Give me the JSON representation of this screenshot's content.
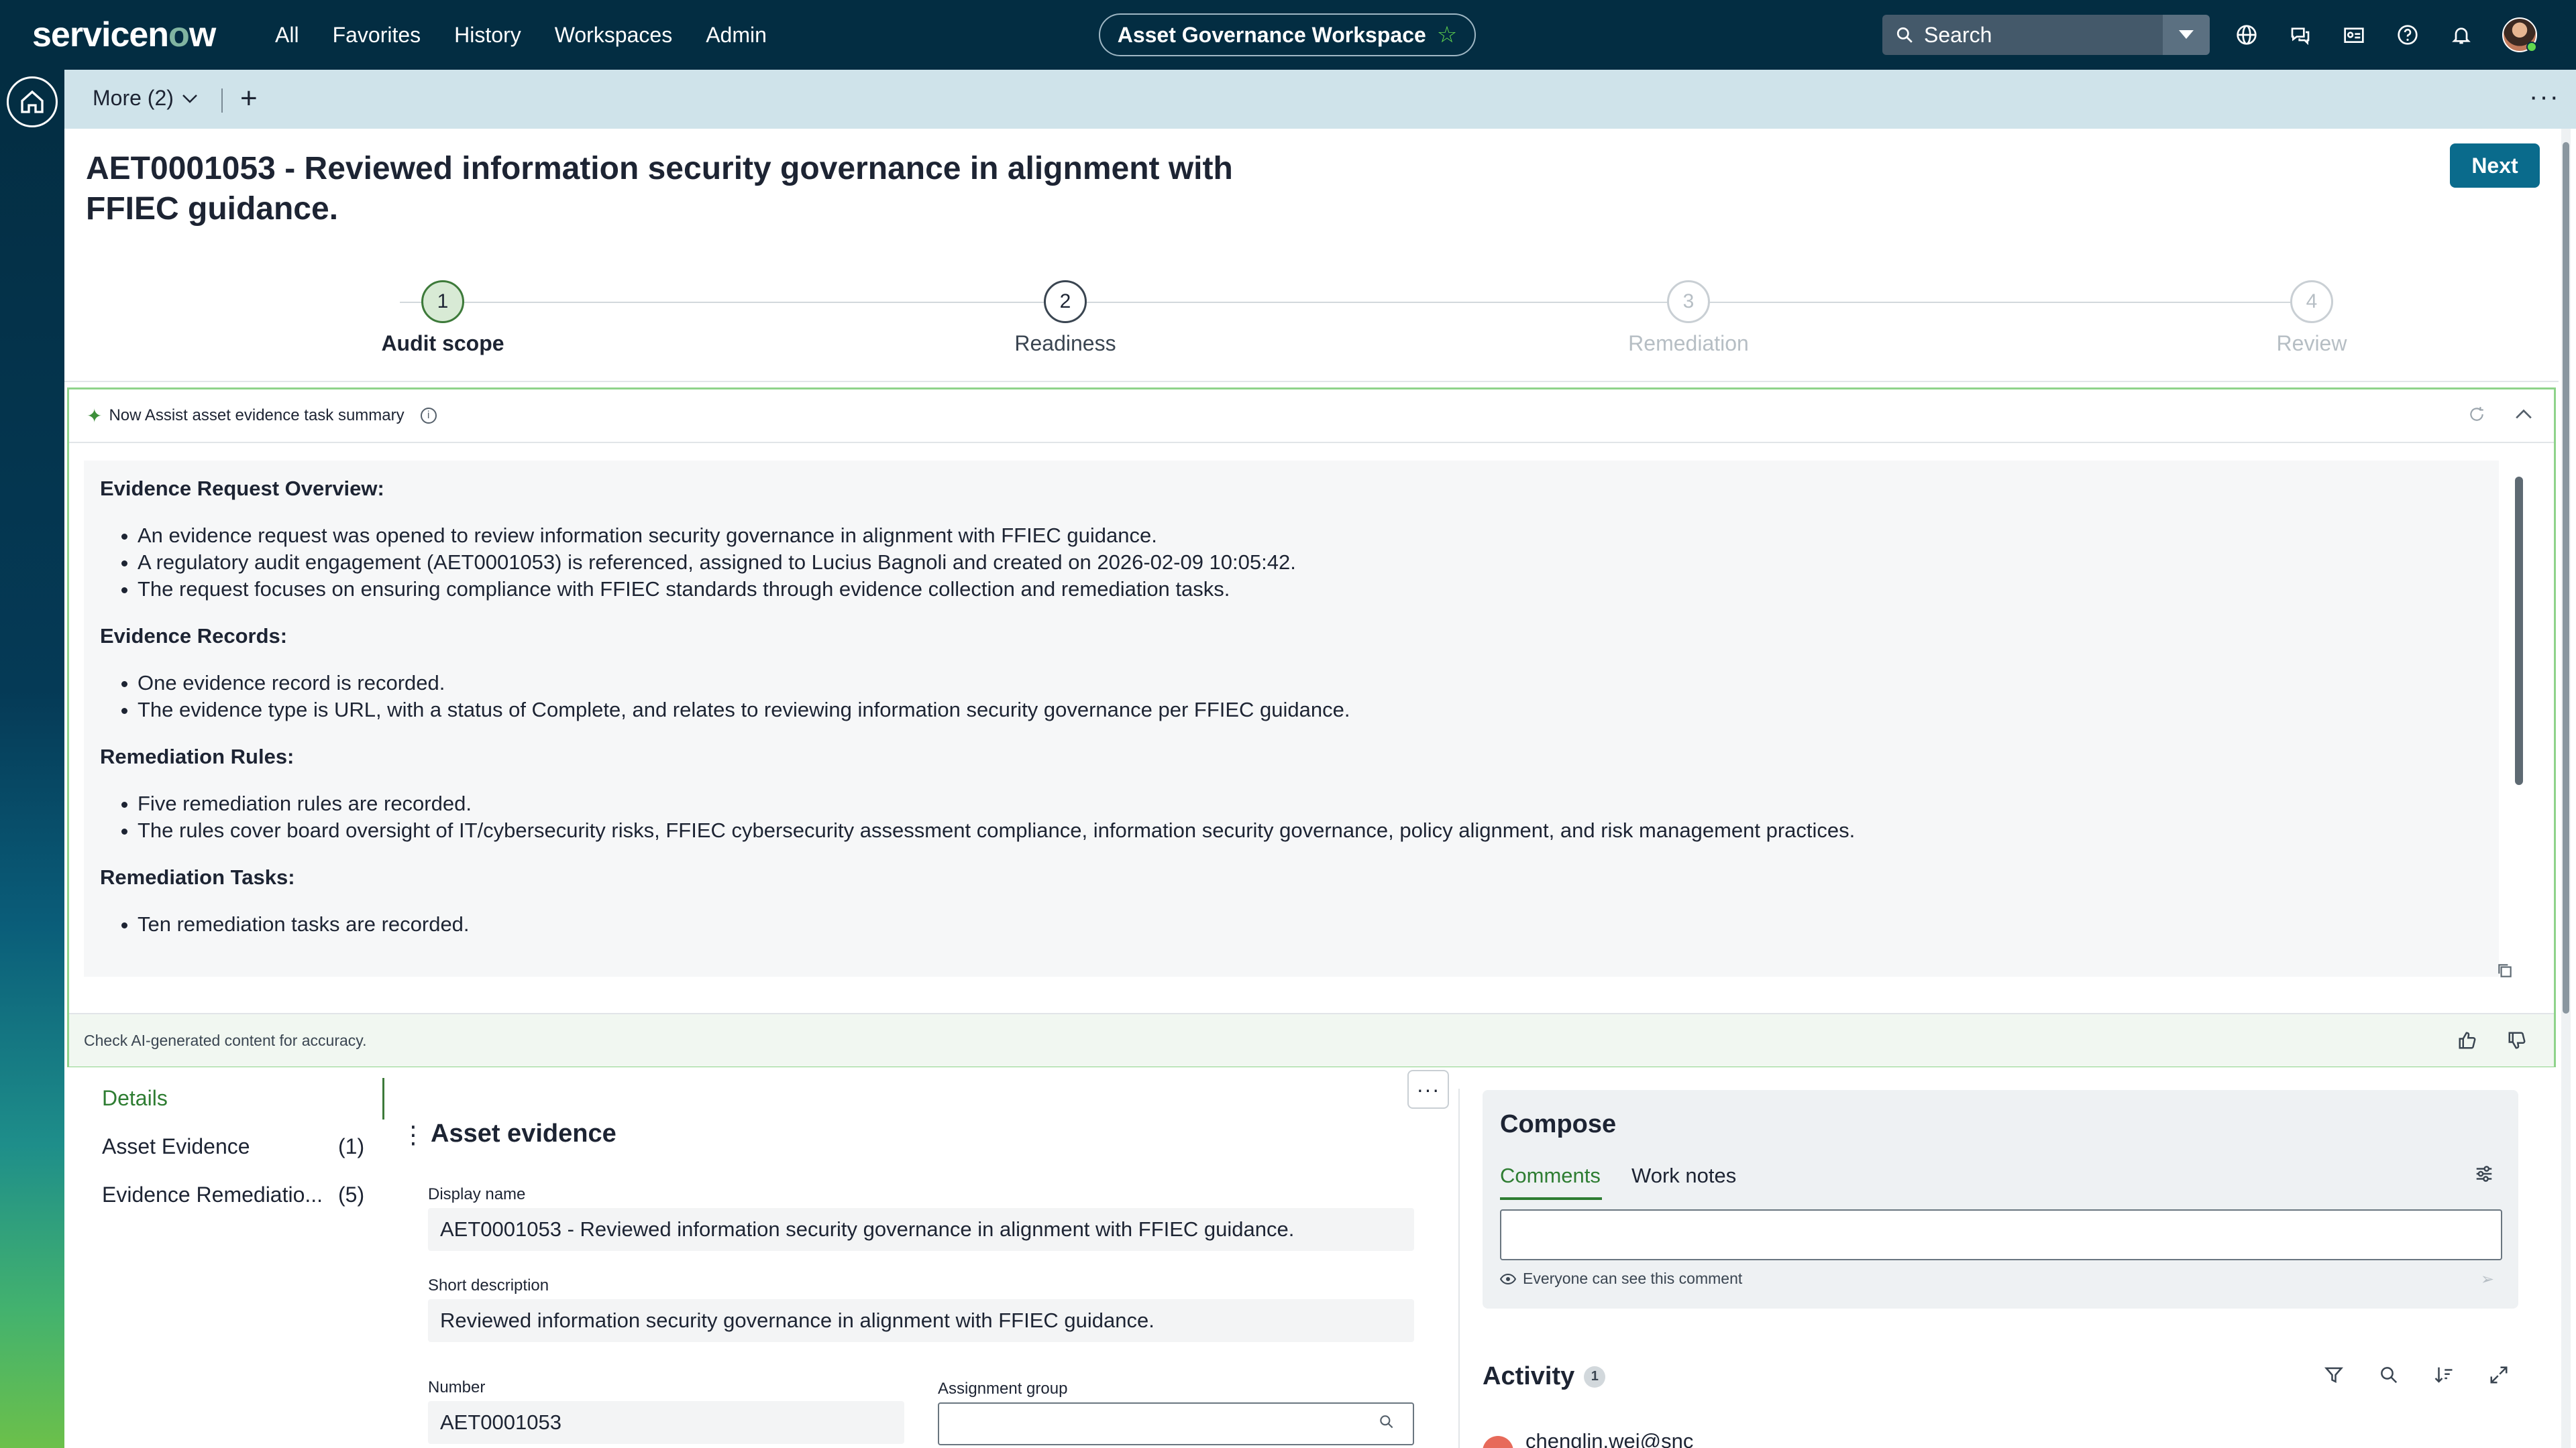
{
  "nav": {
    "logo_part1": "servicen",
    "logo_o": "o",
    "logo_part2": "w",
    "links": [
      "All",
      "Favorites",
      "History",
      "Workspaces",
      "Admin"
    ],
    "workspace": "Asset Governance Workspace",
    "search_placeholder": "Search"
  },
  "tabbar": {
    "more": "More (2)"
  },
  "page": {
    "title": "AET0001053 - Reviewed information security governance in alignment with FFIEC guidance.",
    "next_label": "Next"
  },
  "stepper": {
    "steps": [
      {
        "num": "1",
        "label": "Audit scope",
        "state": "active"
      },
      {
        "num": "2",
        "label": "Readiness",
        "state": "normal"
      },
      {
        "num": "3",
        "label": "Remediation",
        "state": "disabled"
      },
      {
        "num": "4",
        "label": "Review",
        "state": "disabled"
      }
    ]
  },
  "ai_summary": {
    "header": "Now Assist asset evidence task summary",
    "sections": [
      {
        "heading": "Evidence Request Overview:",
        "bullets": [
          "An evidence request was opened to review information security governance in alignment with FFIEC guidance.",
          "A regulatory audit engagement (AET0001053) is referenced, assigned to Lucius Bagnoli and created on 2026-02-09 10:05:42.",
          "The request focuses on ensuring compliance with FFIEC standards through evidence collection and remediation tasks."
        ]
      },
      {
        "heading": "Evidence Records:",
        "bullets": [
          "One evidence record is recorded.",
          "The evidence type is URL, with a status of Complete, and relates to reviewing information security governance per FFIEC guidance."
        ]
      },
      {
        "heading": "Remediation Rules:",
        "bullets": [
          "Five remediation rules are recorded.",
          "The rules cover board oversight of IT/cybersecurity risks, FFIEC cybersecurity assessment compliance, information security governance, policy alignment, and risk management practices."
        ]
      },
      {
        "heading": "Remediation Tasks:",
        "bullets": [
          "Ten remediation tasks are recorded."
        ]
      }
    ],
    "footer": "Check AI-generated content for accuracy."
  },
  "left_nav": {
    "items": [
      {
        "label": "Details",
        "count": ""
      },
      {
        "label": "Asset Evidence",
        "count": "(1)"
      },
      {
        "label": "Evidence Remediatio...",
        "count": "(5)"
      }
    ]
  },
  "form": {
    "title": "Asset evidence",
    "display_name_label": "Display name",
    "display_name_value": "AET0001053 - Reviewed information security governance in alignment with FFIEC guidance.",
    "short_desc_label": "Short description",
    "short_desc_value": "Reviewed information security governance in alignment with FFIEC guidance.",
    "number_label": "Number",
    "number_value": "AET0001053",
    "assignment_group_label": "Assignment group",
    "assignment_group_value": ""
  },
  "compose": {
    "title": "Compose",
    "tab_comments": "Comments",
    "tab_work_notes": "Work notes",
    "visibility_note": "Everyone can see this comment"
  },
  "activity": {
    "title": "Activity",
    "count": "1",
    "first_user": "chenglin.wei@snc"
  }
}
